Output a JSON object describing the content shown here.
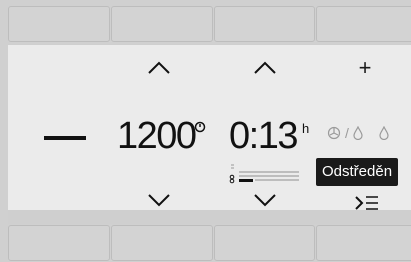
{
  "display": {
    "speed_value": "1200",
    "time_value": "0:13",
    "time_unit": "h",
    "tooltip": "Odstředěn"
  },
  "buttons": {
    "plus_label": "+"
  },
  "icons": {
    "minus": "minus-icon",
    "up_speed": "chevron-up-icon",
    "up_time": "chevron-up-icon",
    "down_speed": "chevron-down-icon",
    "down_time": "chevron-down-icon",
    "rpm": "spin-rpm-icon",
    "fan": "fan-icon",
    "drop": "water-drop-icon",
    "menu": "menu-more-icon"
  },
  "colors": {
    "screen_bg": "#ebebeb",
    "frame_bg": "#d0d0d0",
    "text": "#111111",
    "icon_muted": "#9a9a9a",
    "tooltip_bg": "#1a1a1a",
    "tooltip_text": "#ffffff"
  }
}
